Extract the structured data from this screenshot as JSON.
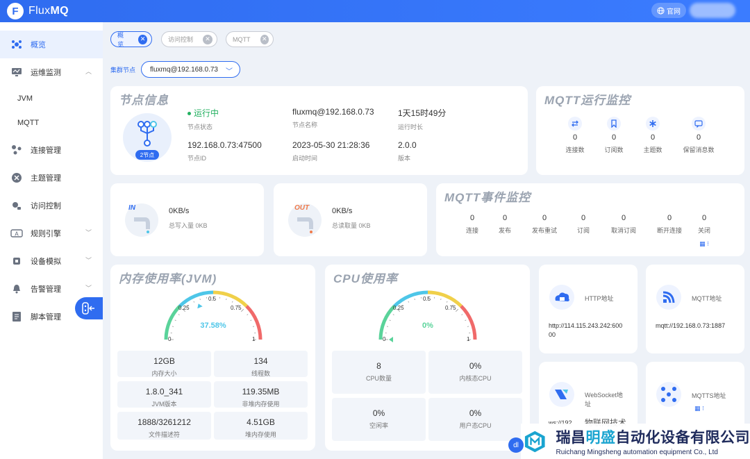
{
  "header": {
    "logo_letter": "F",
    "app_name_prefix": "Flux",
    "app_name_suffix": "MQ",
    "site_button": "官网"
  },
  "sidebar": {
    "items": [
      {
        "label": "概览",
        "icon": "dashboard-icon"
      },
      {
        "label": "运维监测",
        "icon": "monitor-icon"
      },
      {
        "label": "JVM",
        "icon": ""
      },
      {
        "label": "MQTT",
        "icon": ""
      },
      {
        "label": "连接管理",
        "icon": "connection-icon"
      },
      {
        "label": "主题管理",
        "icon": "topic-icon"
      },
      {
        "label": "访问控制",
        "icon": "access-icon"
      },
      {
        "label": "规则引擎",
        "icon": "rule-icon"
      },
      {
        "label": "设备模拟",
        "icon": "device-icon"
      },
      {
        "label": "告警管理",
        "icon": "alarm-icon"
      },
      {
        "label": "脚本管理",
        "icon": "script-icon"
      }
    ]
  },
  "tabs": [
    "概览",
    "访问控制",
    "MQTT"
  ],
  "cluster": {
    "label": "集群节点",
    "value": "fluxmq@192.168.0.73"
  },
  "node_info": {
    "title": "节点信息",
    "badge": "2节点",
    "status_value": "运行中",
    "status_label": "节点状态",
    "name_value": "fluxmq@192.168.0.73",
    "name_label": "节点名称",
    "uptime_value": "1天15时49分",
    "uptime_label": "运行时长",
    "id_value": "192.168.0.73:47500",
    "id_label": "节点ID",
    "start_value": "2023-05-30 21:28:36",
    "start_label": "启动时间",
    "version_value": "2.0.0",
    "version_label": "版本"
  },
  "mqtt_run": {
    "title": "MQTT运行监控",
    "stats": [
      {
        "value": "0",
        "label": "连接数",
        "icon": "swap-icon"
      },
      {
        "value": "0",
        "label": "订阅数",
        "icon": "bookmark-icon"
      },
      {
        "value": "0",
        "label": "主题数",
        "icon": "asterisk-icon"
      },
      {
        "value": "0",
        "label": "保留消息数",
        "icon": "message-icon"
      }
    ]
  },
  "io": {
    "in_tag": "IN",
    "in_value": "0KB/s",
    "in_label": "总写入量 0KB",
    "out_tag": "OUT",
    "out_value": "0KB/s",
    "out_label": "总读取量 0KB"
  },
  "mqtt_event": {
    "title": "MQTT事件监控",
    "stats": [
      {
        "value": "0",
        "label": "连接"
      },
      {
        "value": "0",
        "label": "发布"
      },
      {
        "value": "0",
        "label": "发布重试"
      },
      {
        "value": "0",
        "label": "订阅"
      },
      {
        "value": "0",
        "label": "取消订阅"
      },
      {
        "value": "0",
        "label": "断开连接"
      },
      {
        "value": "0",
        "label": "关闭"
      }
    ]
  },
  "memory": {
    "title": "内存使用率(JVM)",
    "gauge_value": "37.58%",
    "gauge_fraction": 0.3758,
    "ticks": [
      "0",
      "0.25",
      "0.5",
      "0.75",
      "1"
    ],
    "cells": [
      {
        "value": "12GB",
        "label": "内存大小"
      },
      {
        "value": "134",
        "label": "线程数"
      },
      {
        "value": "1.8.0_341",
        "label": "JVM版本"
      },
      {
        "value": "119.35MB",
        "label": "非堆内存使用"
      },
      {
        "value": "1888/3261212",
        "label": "文件描述符"
      },
      {
        "value": "4.51GB",
        "label": "堆内存使用"
      }
    ]
  },
  "cpu": {
    "title": "CPU使用率",
    "gauge_value": "0%",
    "gauge_fraction": 0,
    "ticks": [
      "0",
      "0.25",
      "0.5",
      "0.75",
      "1"
    ],
    "cells": [
      {
        "value": "8",
        "label": "CPU数量"
      },
      {
        "value": "0%",
        "label": "内核态CPU"
      },
      {
        "value": "0%",
        "label": "空闲率"
      },
      {
        "value": "0%",
        "label": "用户态CPU"
      }
    ]
  },
  "addresses": {
    "http_title": "HTTP地址",
    "http_value_line1": "http://114.115.243.242:600",
    "http_value_line2": "00",
    "mqtt_title": "MQTT地址",
    "mqtt_value": "mqtt://192.168.0.73:1887",
    "ws_title_line1": "WebSocket地",
    "ws_title_line2": "址",
    "ws_value": "ws://192",
    "mqtts_title": "MQTTS地址"
  },
  "watermark": {
    "handle": "物联网技术",
    "company_cn_1": "瑞昌",
    "company_cn_2": "明盛",
    "company_cn_3": "自动化设备有限公司",
    "company_en": "Ruichang Mingsheng automation equipment Co., Ltd"
  },
  "colors": {
    "primary": "#2f6cf0",
    "gauge_low": "#5ad39a",
    "gauge_mid": "#4ec6e8",
    "gauge_high": "#f0d04a",
    "gauge_max": "#f06a6a",
    "gauge_text": "#4ec6e8"
  }
}
